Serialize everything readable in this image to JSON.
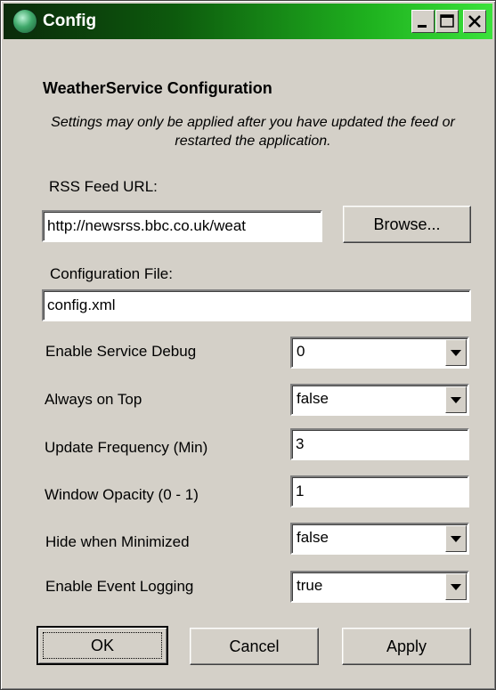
{
  "window": {
    "title": "Config"
  },
  "header": {
    "heading": "WeatherService Configuration",
    "note": "Settings may only be applied after you have updated the feed or restarted the application."
  },
  "rss": {
    "label": "RSS Feed URL:",
    "value": "http://newsrss.bbc.co.uk/weat",
    "browse_label": "Browse..."
  },
  "config_file": {
    "label": "Configuration File:",
    "value": "config.xml"
  },
  "settings": {
    "service_debug": {
      "label": "Enable Service Debug",
      "value": "0"
    },
    "always_on_top": {
      "label": "Always on Top",
      "value": "false"
    },
    "update_frequency": {
      "label": "Update Frequency (Min)",
      "value": "3"
    },
    "window_opacity": {
      "label": "Window Opacity (0 - 1)",
      "value": "1"
    },
    "hide_minimized": {
      "label": "Hide when Minimized",
      "value": "false"
    },
    "event_logging": {
      "label": "Enable Event Logging",
      "value": "true"
    }
  },
  "buttons": {
    "ok": "OK",
    "cancel": "Cancel",
    "apply": "Apply"
  },
  "colors": {
    "titlebar_start": "#0a2a0a",
    "titlebar_end": "#3be23b",
    "face": "#d4d0c8"
  }
}
